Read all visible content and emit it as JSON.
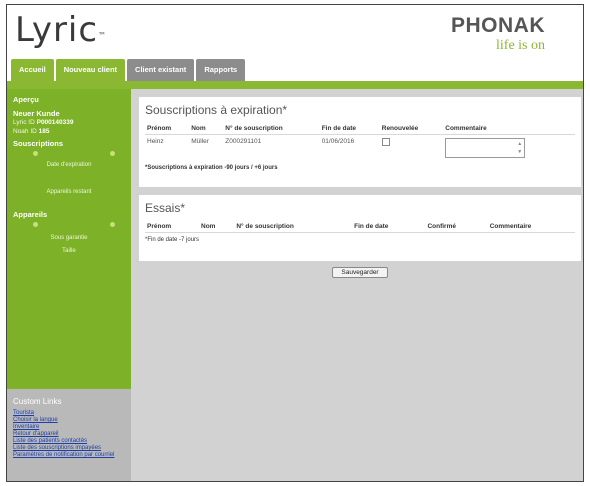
{
  "header": {
    "logo": "Lyric",
    "logo_tm": "™",
    "brand": "PHONAK",
    "brand_tagline": "life is on"
  },
  "tabs": [
    {
      "label": "Accueil"
    },
    {
      "label": "Nouveau client"
    },
    {
      "label": "Client existant"
    },
    {
      "label": "Rapports"
    }
  ],
  "sidebar": {
    "apercu": "Aperçu",
    "patient_name": "Neuer Kunde",
    "lyric_id_label": "Lyric ID",
    "lyric_id_value": "P000140339",
    "noah_id_label": "Noah ID",
    "noah_id_value": "185",
    "souscriptions": "Souscriptions",
    "date_expiration": "Date d'expiration",
    "appareils_restant": "Appareils restant",
    "appareils": "Appareils",
    "sous_garantie": "Sous garantie",
    "taille": "Taille"
  },
  "custom_links": {
    "title": "Custom Links",
    "items": [
      "Tourista",
      "Choisir la langue",
      "Inventaire",
      "Retour d'appareil",
      "Liste des patients contactés",
      "Liste des souscriptions impayées",
      "Paramètres de notification par courriel"
    ]
  },
  "expiring": {
    "title": "Souscriptions à expiration*",
    "columns": [
      "Prénom",
      "Nom",
      "N° de souscription",
      "Fin de date",
      "Renouvelée",
      "Commentaire"
    ],
    "rows": [
      {
        "prenom": "Heinz",
        "nom": "Müller",
        "numero": "Z000291101",
        "fin": "01/06/2016"
      }
    ],
    "note": "*Souscriptions à expiration -90 jours / +6 jours"
  },
  "essais": {
    "title": "Essais*",
    "columns": [
      "Prénom",
      "Nom",
      "N° de souscription",
      "Fin de date",
      "Confirmé",
      "Commentaire"
    ],
    "note": "*Fin de date -7 jours"
  },
  "save_label": "Sauvegarder",
  "colors": {
    "green": "#8ab832",
    "grey_tab": "#8c8c8c"
  }
}
